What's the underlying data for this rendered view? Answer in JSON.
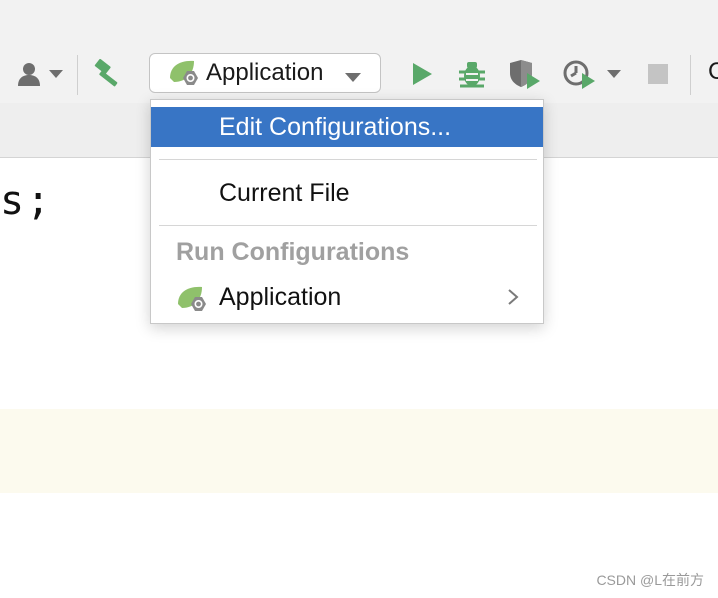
{
  "toolbar": {
    "run_config": {
      "label": "Application",
      "icon": "spring-boot-icon"
    },
    "icons": [
      "user-icon",
      "chevron-down-icon",
      "build-hammer-icon",
      "run-icon",
      "debug-icon",
      "coverage-icon",
      "profile-icon",
      "chevron-down-icon",
      "stop-icon"
    ],
    "truncated_text": "C"
  },
  "editor": {
    "code_fragment": "s;"
  },
  "menu": {
    "edit_configurations": "Edit Configurations...",
    "current_file": "Current File",
    "section_header": "Run Configurations",
    "run_config_item": {
      "label": "Application",
      "icon": "spring-boot-icon",
      "has_submenu": true
    }
  },
  "watermark": "CSDN @L在前方",
  "colors": {
    "selection": "#3875c5",
    "run_green": "#59a869",
    "spring_green": "#6db33f",
    "highlight_band": "#fcfaee"
  }
}
